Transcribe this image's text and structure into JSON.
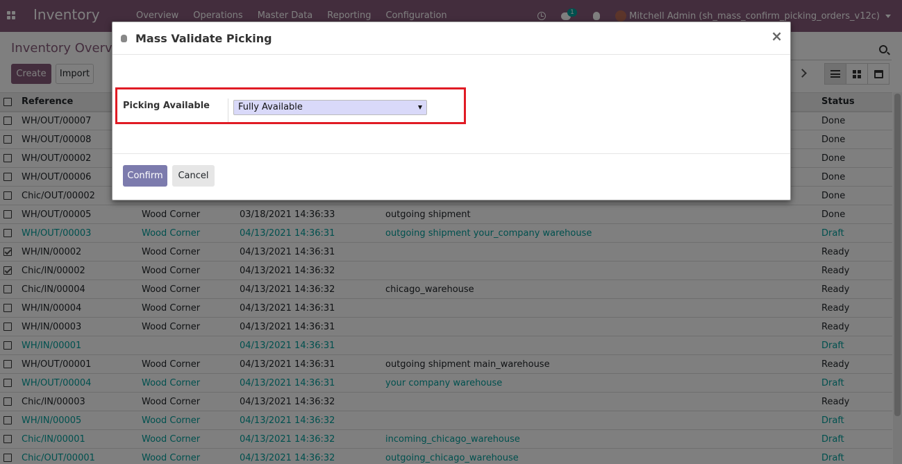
{
  "app": {
    "brand": "Inventory",
    "menu": [
      "Overview",
      "Operations",
      "Master Data",
      "Reporting",
      "Configuration"
    ],
    "chat_count": "1",
    "user": "Mitchell Admin (sh_mass_confirm_picking_orders_v12c)"
  },
  "control_panel": {
    "title": "Inventory Overview",
    "create_label": "Create",
    "import_label": "Import"
  },
  "table": {
    "headers": {
      "reference": "Reference",
      "status": "Status"
    },
    "rows": [
      {
        "reference": "WH/OUT/00007",
        "contact": "",
        "date": "",
        "source": "",
        "status": "Done",
        "checked": false,
        "draft": false
      },
      {
        "reference": "WH/OUT/00008",
        "contact": "",
        "date": "",
        "source": "",
        "status": "Done",
        "checked": false,
        "draft": false
      },
      {
        "reference": "WH/OUT/00002",
        "contact": "",
        "date": "",
        "source": "",
        "status": "Done",
        "checked": false,
        "draft": false
      },
      {
        "reference": "WH/OUT/00006",
        "contact": "",
        "date": "",
        "source": "",
        "status": "Done",
        "checked": false,
        "draft": false
      },
      {
        "reference": "Chic/OUT/00002",
        "contact": "",
        "date": "",
        "source": "",
        "status": "Done",
        "checked": false,
        "draft": false
      },
      {
        "reference": "WH/OUT/00005",
        "contact": "Wood Corner",
        "date": "03/18/2021 14:36:33",
        "source": "outgoing shipment",
        "status": "Done",
        "checked": false,
        "draft": false
      },
      {
        "reference": "WH/OUT/00003",
        "contact": "Wood Corner",
        "date": "04/13/2021 14:36:31",
        "source": "outgoing shipment your_company warehouse",
        "status": "Draft",
        "checked": false,
        "draft": true
      },
      {
        "reference": "WH/IN/00002",
        "contact": "Wood Corner",
        "date": "04/13/2021 14:36:31",
        "source": "",
        "status": "Ready",
        "checked": true,
        "draft": false
      },
      {
        "reference": "Chic/IN/00002",
        "contact": "Wood Corner",
        "date": "04/13/2021 14:36:32",
        "source": "",
        "status": "Ready",
        "checked": true,
        "draft": false
      },
      {
        "reference": "Chic/IN/00004",
        "contact": "Wood Corner",
        "date": "04/13/2021 14:36:32",
        "source": "chicago_warehouse",
        "status": "Ready",
        "checked": false,
        "draft": false
      },
      {
        "reference": "WH/IN/00004",
        "contact": "Wood Corner",
        "date": "04/13/2021 14:36:31",
        "source": "",
        "status": "Ready",
        "checked": false,
        "draft": false
      },
      {
        "reference": "WH/IN/00003",
        "contact": "Wood Corner",
        "date": "04/13/2021 14:36:31",
        "source": "",
        "status": "Ready",
        "checked": false,
        "draft": false
      },
      {
        "reference": "WH/IN/00001",
        "contact": "",
        "date": "04/13/2021 14:36:31",
        "source": "",
        "status": "Draft",
        "checked": false,
        "draft": true
      },
      {
        "reference": "WH/OUT/00001",
        "contact": "Wood Corner",
        "date": "04/13/2021 14:36:31",
        "source": "outgoing shipment main_warehouse",
        "status": "Ready",
        "checked": false,
        "draft": false
      },
      {
        "reference": "WH/OUT/00004",
        "contact": "Wood Corner",
        "date": "04/13/2021 14:36:31",
        "source": "your company warehouse",
        "status": "Draft",
        "checked": false,
        "draft": true
      },
      {
        "reference": "Chic/IN/00003",
        "contact": "Wood Corner",
        "date": "04/13/2021 14:36:32",
        "source": "",
        "status": "Ready",
        "checked": false,
        "draft": false
      },
      {
        "reference": "WH/IN/00005",
        "contact": "Wood Corner",
        "date": "04/13/2021 14:36:32",
        "source": "",
        "status": "Draft",
        "checked": false,
        "draft": true
      },
      {
        "reference": "Chic/IN/00001",
        "contact": "Wood Corner",
        "date": "04/13/2021 14:36:32",
        "source": "incoming_chicago_warehouse",
        "status": "Draft",
        "checked": false,
        "draft": true
      },
      {
        "reference": "Chic/OUT/00001",
        "contact": "Wood Corner",
        "date": "04/13/2021 14:36:32",
        "source": "outgoing_chicago_warehouse",
        "status": "Draft",
        "checked": false,
        "draft": true
      }
    ]
  },
  "modal": {
    "title": "Mass Validate Picking",
    "close_glyph": "×",
    "field_label": "Picking Available",
    "field_value": "Fully Available",
    "confirm_label": "Confirm",
    "cancel_label": "Cancel"
  },
  "colors": {
    "navbar": "#875a7b",
    "draft_text": "#00a09d",
    "confirm_button": "#7c7bad",
    "highlight_border": "#e01b24",
    "select_background": "#d9d9f9"
  }
}
